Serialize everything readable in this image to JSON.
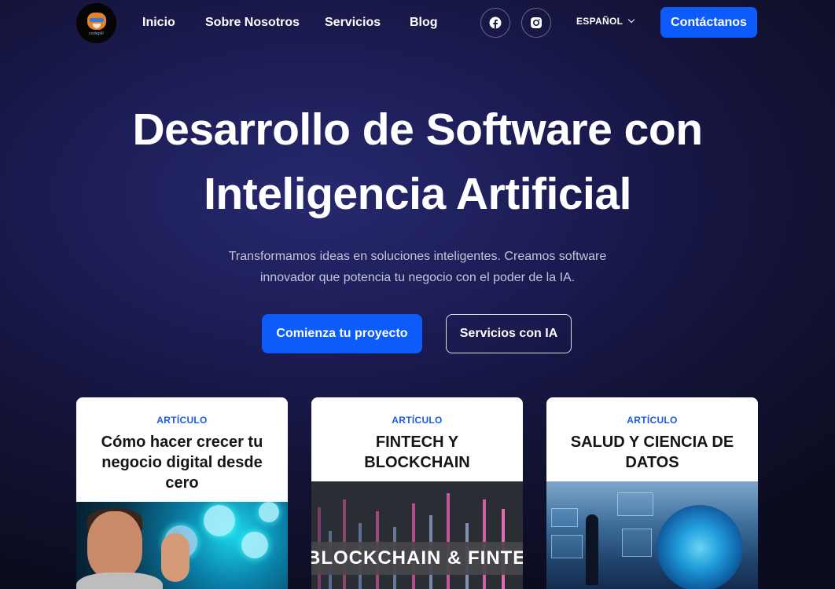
{
  "nav": {
    "logo_text": "codepill",
    "links": [
      "Inicio",
      "Sobre Nosotros",
      "Servicios",
      "Blog"
    ],
    "social": [
      {
        "name": "facebook",
        "icon": "facebook-icon"
      },
      {
        "name": "instagram",
        "icon": "instagram-icon"
      }
    ],
    "language": "ESPAÑOL",
    "contact_label": "Contáctanos"
  },
  "hero": {
    "title_line1": "Desarrollo de Software con",
    "title_line2": "Inteligencia Artificial",
    "subtitle_line1": "Transformamos ideas en soluciones inteligentes. Creamos software",
    "subtitle_line2": "innovador que potencia tu negocio con el poder de la IA.",
    "primary_cta": "Comienza tu proyecto",
    "secondary_cta": "Servicios con IA"
  },
  "cards": [
    {
      "kicker": "ARTÍCULO",
      "title": "Cómo hacer crecer tu negocio digital desde cero"
    },
    {
      "kicker": "ARTÍCULO",
      "title": "FINTECH Y BLOCKCHAIN",
      "image_text": "BLOCKCHAIN & FINTECH"
    },
    {
      "kicker": "ARTÍCULO",
      "title": "SALUD Y CIENCIA DE DATOS"
    }
  ],
  "colors": {
    "accent": "#0d5bfa",
    "kicker": "#1a5be0",
    "background": "#1c1c55"
  }
}
